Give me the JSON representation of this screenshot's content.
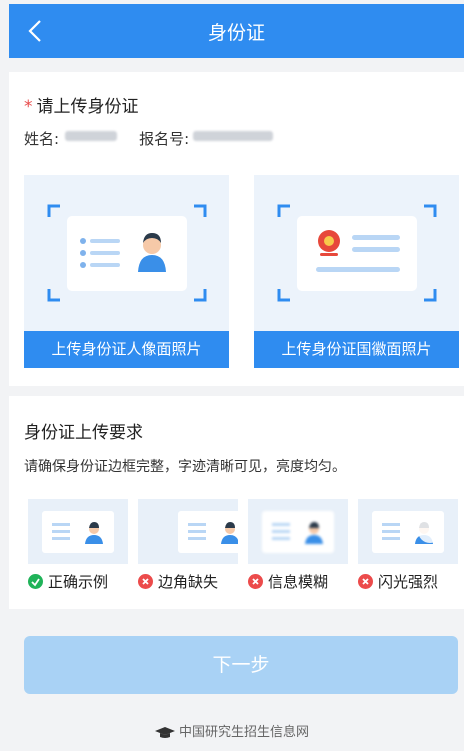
{
  "header": {
    "title": "身份证"
  },
  "upload": {
    "required_mark": "*",
    "title": "请上传身份证",
    "name_label": "姓名:",
    "reg_label": "报名号:",
    "front_button": "上传身份证人像面照片",
    "back_button": "上传身份证国徽面照片"
  },
  "requirements": {
    "title": "身份证上传要求",
    "desc": "请确保身份证边框完整，字迹清晰可见，亮度均匀。",
    "samples": [
      {
        "label": "正确示例",
        "status": "ok"
      },
      {
        "label": "边角缺失",
        "status": "bad"
      },
      {
        "label": "信息模糊",
        "status": "bad"
      },
      {
        "label": "闪光强烈",
        "status": "bad"
      }
    ]
  },
  "next_button": "下一步",
  "footer": {
    "text": "中国研究生招生信息网"
  },
  "colors": {
    "primary": "#2f8cf0",
    "disabled": "#a9d2f5",
    "ok": "#20b359",
    "bad": "#ec4b4b"
  }
}
